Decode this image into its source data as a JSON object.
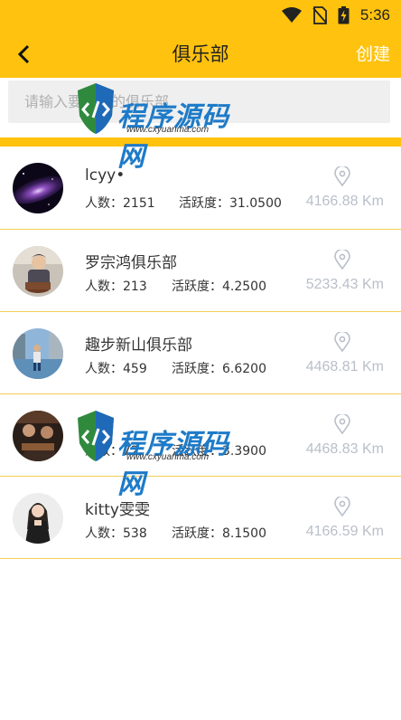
{
  "status_bar": {
    "time": "5:36"
  },
  "nav": {
    "title": "俱乐部",
    "create_label": "创建"
  },
  "search": {
    "placeholder": "请输入要搜索的俱乐部",
    "value": ""
  },
  "clubs": [
    {
      "name": "lcyy•",
      "members": "人数：2151",
      "activity": "活跃度：31.0500",
      "distance": "4166.88 Km",
      "avatar_icon": "galaxy-photo"
    },
    {
      "name": "罗宗鸿俱乐部",
      "members": "人数：213",
      "activity": "活跃度：4.2500",
      "distance": "5233.43 Km",
      "avatar_icon": "person-cake-photo"
    },
    {
      "name": "趣步新山俱乐部",
      "members": "人数：459",
      "activity": "活跃度：6.6200",
      "distance": "4468.81 Km",
      "avatar_icon": "person-outdoor-photo"
    },
    {
      "name": "",
      "members": "人数：72",
      "activity": "活跃度：3.3900",
      "distance": "4468.83 Km",
      "avatar_icon": "group-photo"
    },
    {
      "name": "kitty雯雯",
      "members": "人数：538",
      "activity": "活跃度：8.1500",
      "distance": "4166.59 Km",
      "avatar_icon": "woman-photo"
    }
  ],
  "watermark": {
    "text": "程序源码网",
    "url": "www.cxyuanma.com"
  },
  "colors": {
    "accent": "#FFC20E",
    "divider": "#F2CF57",
    "distance_text": "#B9BFC9",
    "white": "#FFFFFF"
  }
}
